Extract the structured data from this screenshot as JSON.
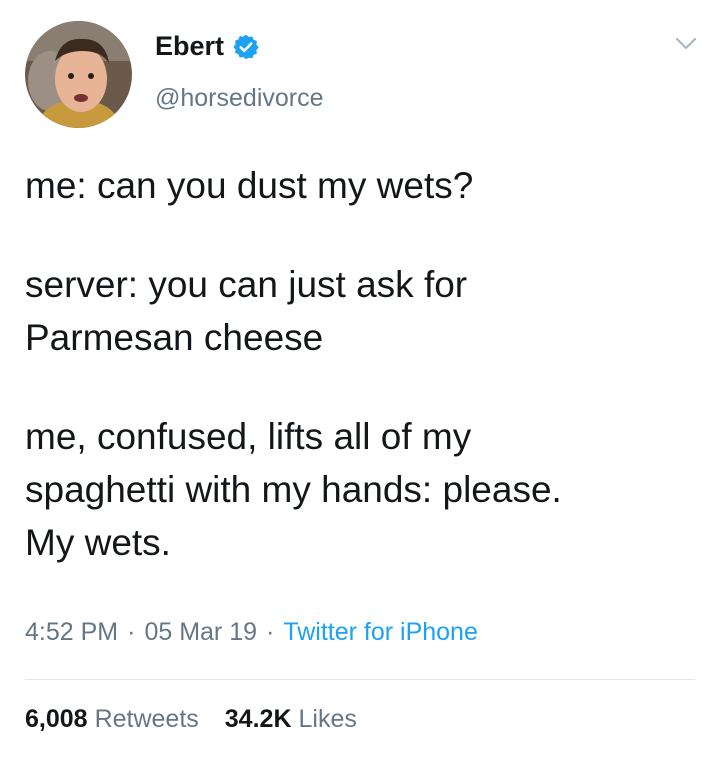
{
  "author": {
    "display_name": "Ebert",
    "handle": "@horsedivorce",
    "verified": true
  },
  "icons": {
    "verified": "verified-badge-icon",
    "menu": "chevron-down-icon"
  },
  "tweet": {
    "paragraphs": [
      "me: can you dust my wets?",
      "server: you can just ask for\nParmesan cheese",
      "me, confused, lifts all of my\nspaghetti with my hands: please.\nMy wets."
    ]
  },
  "meta": {
    "time": "4:52 PM",
    "date": "05 Mar 19",
    "separator": "·",
    "source": "Twitter for iPhone"
  },
  "stats": {
    "retweets_count": "6,008",
    "retweets_label": "Retweets",
    "likes_count": "34.2K",
    "likes_label": "Likes"
  },
  "colors": {
    "accent": "#1da1f2",
    "secondary_text": "#657786",
    "primary_text": "#14171a",
    "divider": "#e1e8ed"
  }
}
